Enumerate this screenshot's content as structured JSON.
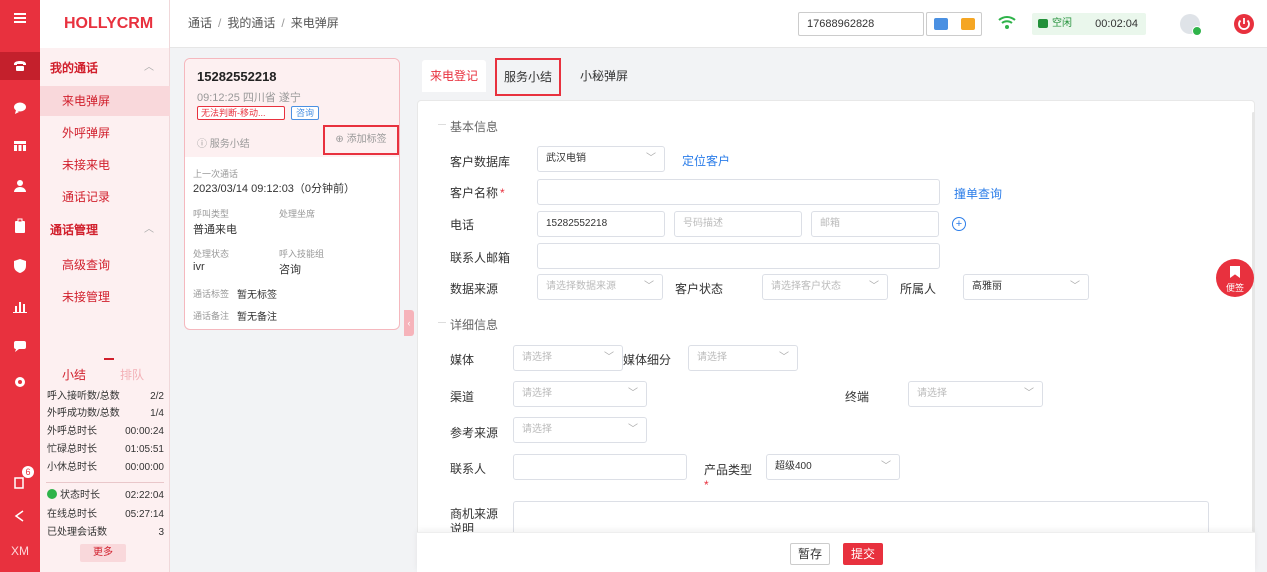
{
  "app": {
    "brand": "HOLLYCRM",
    "user_initials": "XM"
  },
  "rail_badge": "6",
  "nav": {
    "groups": [
      {
        "label": "我的通话",
        "items": [
          "来电弹屏",
          "外呼弹屏",
          "未接来电",
          "通话记录"
        ]
      },
      {
        "label": "通话管理",
        "items": [
          "高级查询",
          "未接管理"
        ]
      }
    ]
  },
  "stats": {
    "tab_active": "小结",
    "tab_inactive": "排队",
    "rows": [
      {
        "label": "呼入接听数/总数",
        "value": "2/2"
      },
      {
        "label": "外呼成功数/总数",
        "value": "1/4"
      },
      {
        "label": "外呼总时长",
        "value": "00:00:24"
      },
      {
        "label": "忙碌总时长",
        "value": "01:05:51"
      },
      {
        "label": "小休总时长",
        "value": "00:00:00"
      },
      {
        "label": "状态时长",
        "value": "02:22:04"
      },
      {
        "label": "在线总时长",
        "value": "05:27:14"
      },
      {
        "label": "已处理会话数",
        "value": "3"
      }
    ],
    "more": "更多"
  },
  "topbar": {
    "breadcrumb": [
      "通话",
      "我的通话",
      "来电弹屏"
    ],
    "phone": "17688962828",
    "status_label": "空闲",
    "status_time": "00:02:04",
    "colors": {
      "accent": "#e8313e",
      "idle": "#23913a"
    }
  },
  "card": {
    "number": "15282552218",
    "meta": "09:12:25 四川省 遂宁",
    "tag_unknown": "无法判断-移动...",
    "tag_type": "咨询",
    "summary_link": "服务小结",
    "add_tag": "添加标签",
    "last_call_label": "上一次通话",
    "last_call_value": "2023/03/14 09:12:03（0分钟前）",
    "call_type_label": "呼叫类型",
    "call_type_value": "普通来电",
    "agent_label": "处理坐席",
    "agent_value": "",
    "handle_status_label": "处理状态",
    "handle_status_value": "ivr",
    "skill_label": "呼入技能组",
    "skill_value": "咨询",
    "call_tag_label": "通话标签",
    "call_tag_value": "暂无标签",
    "call_note_label": "通话备注",
    "call_note_value": "暂无备注"
  },
  "tabs": [
    "来电登记",
    "服务小结",
    "小秘弹屏"
  ],
  "form": {
    "section_basic": "基本信息",
    "customer_db_label": "客户数据库",
    "customer_db_value": "武汉电销",
    "locate_customer": "定位客户",
    "customer_name_label": "客户名称",
    "customer_name_required": "*",
    "duplicate_check": "撞单查询",
    "phone_label": "电话",
    "phone_value": "15282552218",
    "phone_desc_ph": "号码描述",
    "email_ph": "邮箱",
    "contact_email_label": "联系人邮箱",
    "data_source_label": "数据来源",
    "data_source_ph": "请选择数据来源",
    "customer_status_label": "客户状态",
    "customer_status_ph": "请选择客户状态",
    "owner_label": "所属人",
    "owner_value": "高雅丽",
    "section_detail": "详细信息",
    "media_label": "媒体",
    "media_ph": "请选择",
    "media_sub_label": "媒体细分",
    "media_sub_ph": "请选择",
    "channel_label": "渠道",
    "channel_ph": "请选择",
    "terminal_label": "终端",
    "terminal_ph": "请选择",
    "ref_source_label": "参考来源",
    "ref_source_ph": "请选择",
    "contact_label": "联系人",
    "product_type_label": "产品类型",
    "product_type_required": "*",
    "product_type_value": "超级400",
    "opportunity_label": "商机来源说明"
  },
  "footer": {
    "save": "暂存",
    "submit": "提交"
  },
  "memo": "便签"
}
